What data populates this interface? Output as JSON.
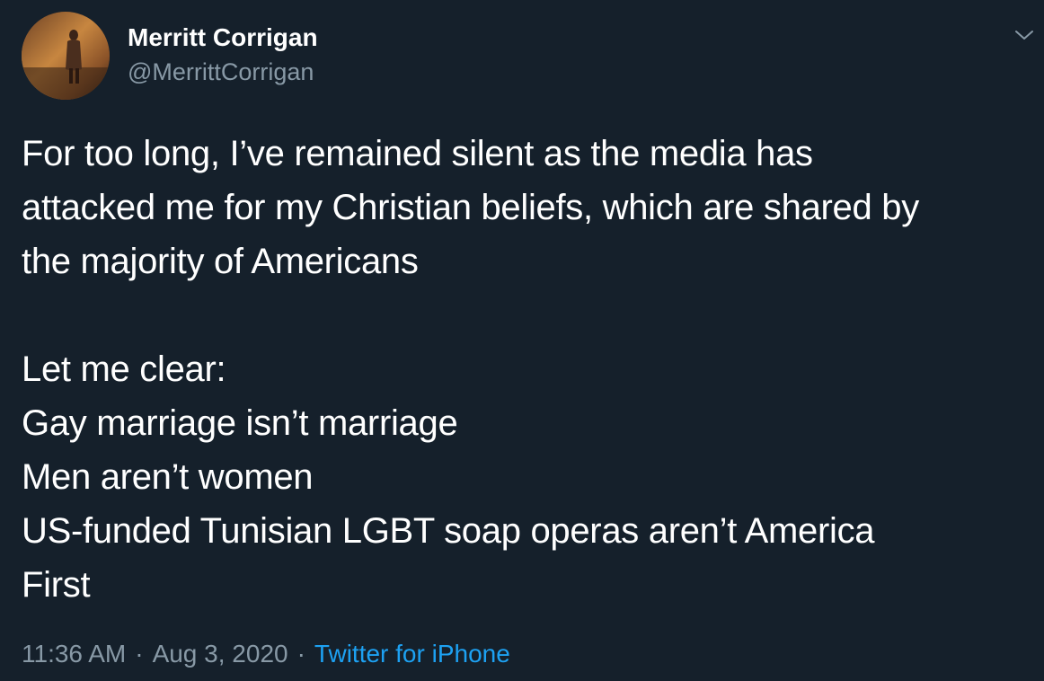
{
  "author": {
    "display_name": "Merritt Corrigan",
    "handle": "@MerrittCorrigan"
  },
  "tweet": {
    "lines": [
      "For too long, I’ve remained silent as the media has",
      "attacked me for my Christian beliefs, which are shared by",
      "the majority of Americans",
      "",
      "Let me clear:",
      "Gay marriage isn’t marriage",
      "Men aren’t women",
      "US-funded Tunisian LGBT soap operas aren’t America",
      "First"
    ]
  },
  "meta": {
    "time": "11:36 AM",
    "separator": "·",
    "date": "Aug 3, 2020",
    "source": "Twitter for iPhone"
  },
  "icons": {
    "more": "chevron-down-icon"
  },
  "colors": {
    "background": "#15202b",
    "text": "#ffffff",
    "secondary": "#8899a6",
    "link": "#1da1f2"
  }
}
